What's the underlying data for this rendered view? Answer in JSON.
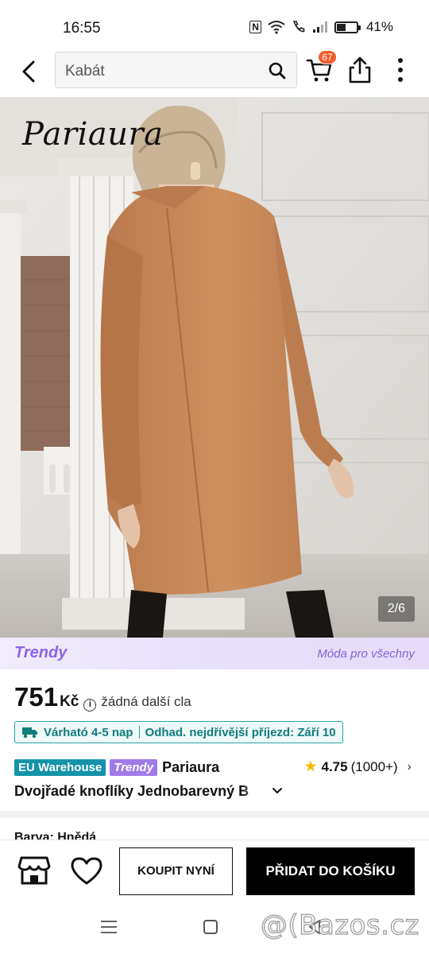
{
  "status_bar": {
    "time": "16:55",
    "nfc_label": "N",
    "battery_percent": "41%"
  },
  "top_bar": {
    "search_query": "Kabát",
    "cart_count": "67"
  },
  "hero": {
    "brand_logo": "Pariaura",
    "image_counter": "2/6"
  },
  "trendy_banner": {
    "logo": "Trendy",
    "tagline": "Móda pro všechny"
  },
  "price": {
    "value": "751",
    "currency": "Kč",
    "info_symbol": "i",
    "duty_note": "žádná další cla"
  },
  "delivery": {
    "estimate": "Várható 4-5 nap",
    "earliest": "Odhad. nejdřívější příjezd: Září 10"
  },
  "tags": {
    "warehouse": "EU Warehouse",
    "trendy": "Trendy",
    "brand": "Pariaura"
  },
  "rating": {
    "score": "4.75",
    "count": "(1000+)"
  },
  "product": {
    "title": "Dvojřadé knoflíky Jednobarevný B",
    "color_label": "Barva: Hnědá"
  },
  "actions": {
    "buy_now": "KOUPIT NYNÍ",
    "add_to_cart": "PŘIDAT DO KOŠÍKU"
  },
  "watermark": "@(Bazos.cz",
  "colors": {
    "accent_purple": "#8e64e6",
    "teal": "#1593a8",
    "badge_orange": "#f25c2a",
    "star": "#f6b800",
    "coat": "#c9885a"
  },
  "icons": [
    "back-arrow-icon",
    "search-icon",
    "cart-icon",
    "share-icon",
    "more-vertical-icon",
    "info-icon",
    "truck-icon",
    "star-icon",
    "chevron-right-icon",
    "chevron-down-icon",
    "store-icon",
    "heart-icon",
    "menu-icon",
    "home-icon",
    "nav-back-icon"
  ]
}
